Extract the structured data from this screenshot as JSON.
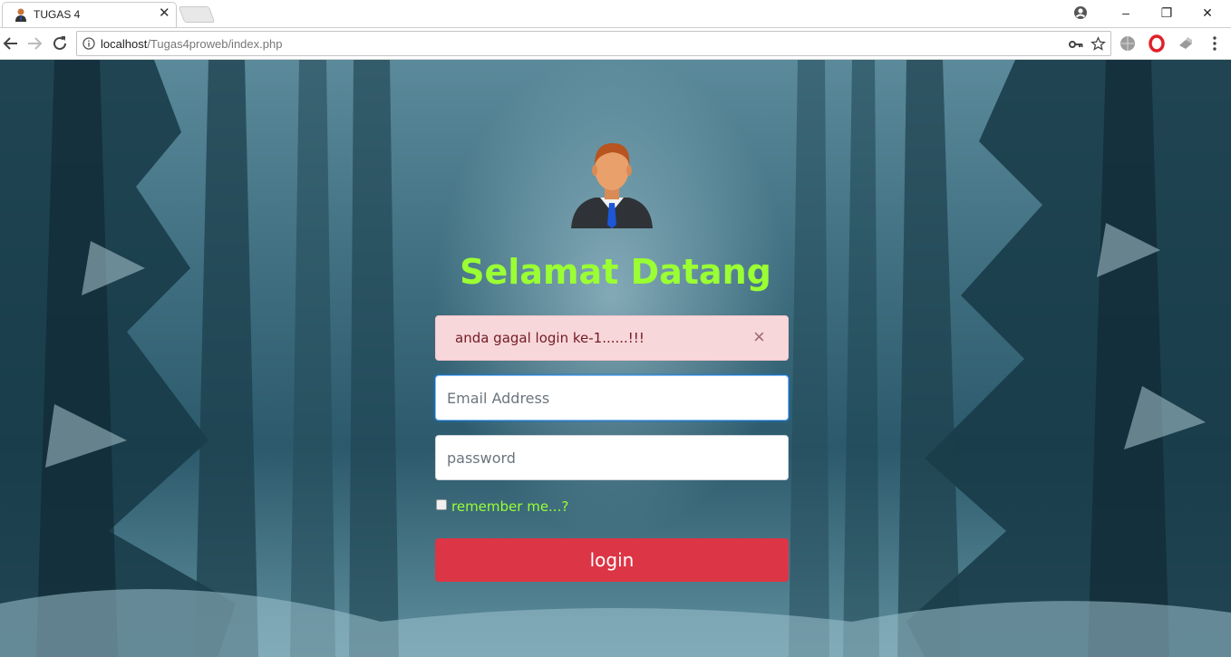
{
  "browser": {
    "tab_title": "TUGAS 4",
    "tab_close": "✕",
    "url_host": "localhost",
    "url_path": "/Tugas4proweb/index.php",
    "window_minimize": "–",
    "window_restore": "❐",
    "window_close": "✕"
  },
  "page": {
    "title": "Selamat Datang",
    "alert_message": "anda gagal login ke-1......!!!",
    "alert_close": "×",
    "email_placeholder": "Email Address",
    "password_placeholder": "password",
    "remember_label": "remember me...?",
    "login_label": "login"
  },
  "colors": {
    "title_green": "#9aff33",
    "alert_bg": "#f8d7da",
    "alert_text": "#721c24",
    "login_red": "#dc3545"
  },
  "icons": [
    "user-avatar-icon",
    "back-icon",
    "forward-icon",
    "reload-icon",
    "info-icon",
    "key-icon",
    "star-icon",
    "globe-icon",
    "opera-icon",
    "extension-icon",
    "menu-icon",
    "account-icon"
  ]
}
